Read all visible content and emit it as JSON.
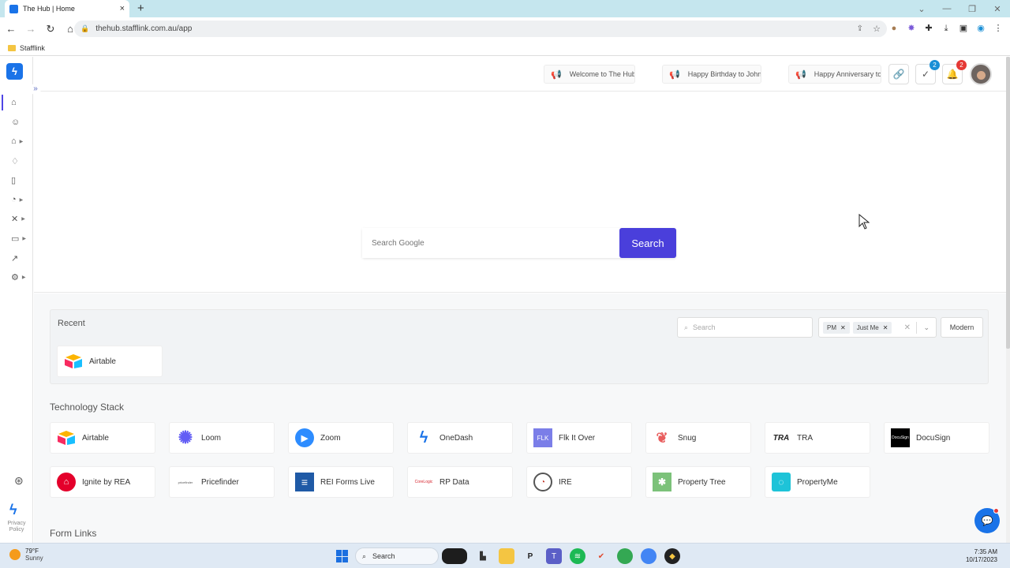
{
  "browser": {
    "tab_title": "The Hub | Home",
    "tab_close": "×",
    "new_tab": "+",
    "url": "thehub.stafflink.com.au/app",
    "bookmark": "Stafflink",
    "window_controls": [
      "⌄",
      "—",
      "❐",
      "✕"
    ]
  },
  "header": {
    "announcements": [
      "Welcome to The Hub!",
      "Happy Birthday to John!",
      "Happy Anniversary to"
    ],
    "tasks_badge": "2",
    "notifications_badge": "2"
  },
  "hero": {
    "search_placeholder": "Search Google",
    "search_button": "Search"
  },
  "recent": {
    "title": "Recent",
    "search_placeholder": "Search",
    "filters": [
      "PM",
      "Just Me"
    ],
    "view_button": "Modern",
    "items": [
      {
        "label": "Airtable",
        "icon": "airtable-icon"
      }
    ]
  },
  "technology_stack": {
    "title": "Technology Stack",
    "items": [
      {
        "label": "Airtable",
        "icon": "airtable-icon"
      },
      {
        "label": "Loom",
        "icon": "loom-icon"
      },
      {
        "label": "Zoom",
        "icon": "zoom-icon"
      },
      {
        "label": "OneDash",
        "icon": "onedash-icon"
      },
      {
        "label": "Flk It Over",
        "icon": "flk-icon",
        "icon_text": "FLK"
      },
      {
        "label": "Snug",
        "icon": "snug-icon"
      },
      {
        "label": "TRA",
        "icon": "tra-icon",
        "icon_text": "TRA"
      },
      {
        "label": "DocuSign",
        "icon": "docusign-icon",
        "icon_text": "DocuSign"
      },
      {
        "label": "Ignite by REA",
        "icon": "rea-icon"
      },
      {
        "label": "Pricefinder",
        "icon": "pricefinder-icon",
        "icon_text": "pricefinder"
      },
      {
        "label": "REI Forms Live",
        "icon": "rei-forms-icon"
      },
      {
        "label": "RP Data",
        "icon": "rp-data-icon",
        "icon_text": "CoreLogic"
      },
      {
        "label": "IRE",
        "icon": "ire-icon"
      },
      {
        "label": "Property Tree",
        "icon": "property-tree-icon"
      },
      {
        "label": "PropertyMe",
        "icon": "propertyme-icon"
      }
    ]
  },
  "form_links": {
    "title": "Form Links"
  },
  "sidebar": {
    "privacy": "Privacy Policy"
  },
  "taskbar": {
    "temperature": "79°F",
    "condition": "Sunny",
    "search": "Search",
    "time": "7:35 AM",
    "date": "10/17/2023"
  },
  "colors": {
    "primary": "#4a3fdb",
    "brand": "#1a73e8",
    "badge_blue": "#1a8fd6",
    "badge_red": "#e53935"
  }
}
